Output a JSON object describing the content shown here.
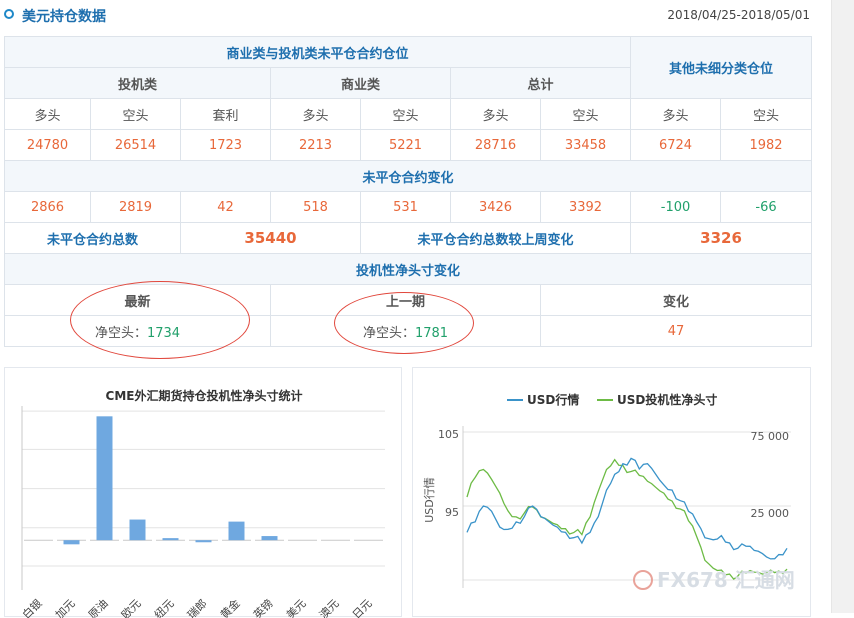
{
  "header": {
    "title": "美元持仓数据",
    "date_range": "2018/04/25-2018/05/01"
  },
  "table": {
    "group_commercial_noncommercial": "商业类与投机类未平仓合约仓位",
    "group_other": "其他未细分类仓位",
    "sub_speculative": "投机类",
    "sub_commercial": "商业类",
    "sub_total": "总计",
    "cols": [
      "多头",
      "空头",
      "套利",
      "多头",
      "空头",
      "多头",
      "空头",
      "多头",
      "空头"
    ],
    "positions": [
      "24780",
      "26514",
      "1723",
      "2213",
      "5221",
      "28716",
      "33458",
      "6724",
      "1982"
    ],
    "change_title": "未平仓合约变化",
    "changes": [
      "2866",
      "2819",
      "42",
      "518",
      "531",
      "3426",
      "3392",
      "-100",
      "-66"
    ],
    "oi_total_label": "未平仓合约总数",
    "oi_total_value": "35440",
    "oi_change_label": "未平仓合约总数较上周变化",
    "oi_change_value": "3326",
    "net_title": "投机性净头寸变化",
    "net_cols": [
      "最新",
      "上一期",
      "变化"
    ],
    "latest_label": "净空头：",
    "latest_value": "1734",
    "previous_label": "净空头：",
    "previous_value": "1781",
    "net_change": "47"
  },
  "colors": {
    "accent": "#1e6fae",
    "red": "#e8683a",
    "green": "#21a06b",
    "bar": "#6fa8e0",
    "usd_line": "#3a93c9",
    "net_line": "#6dbb45",
    "annotation": "#e1473c"
  },
  "chart_data": [
    {
      "type": "bar",
      "title": "CME外汇期货持仓投机性净头寸统计",
      "categories": [
        "白银",
        "加元",
        "原油",
        "欧元",
        "纽元",
        "瑞郎",
        "黄金",
        "英镑",
        "美元",
        "澳元",
        "日元"
      ],
      "values": [
        0,
        -4,
        120,
        20,
        2,
        -2,
        18,
        4,
        0,
        0,
        0
      ],
      "ylim": [
        -25,
        130
      ],
      "grid": true
    },
    {
      "type": "line",
      "legend": [
        "USD行情",
        "USD投机性净头寸"
      ],
      "left_axis": {
        "label": "USD行情",
        "ticks": [
          "105",
          "95"
        ]
      },
      "right_axis": {
        "ticks": [
          "75 000",
          "25 000"
        ]
      },
      "series": [
        {
          "name": "USD行情",
          "values": [
            95.5,
            96.5,
            98.0,
            97.5,
            96.0,
            95.8,
            96.5,
            97.0,
            98.0,
            97.0,
            96.5,
            96.0,
            95.5,
            95.0,
            94.5,
            95.5,
            97.0,
            99.5,
            101.0,
            102.0,
            102.5,
            101.5,
            102.0,
            101.0,
            100.0,
            99.5,
            98.5,
            97.5,
            96.5,
            95.0,
            94.8,
            95.2,
            94.5,
            94.0,
            94.2,
            93.8,
            93.5,
            93.0,
            93.4,
            94.0
          ]
        },
        {
          "name": "USD投机性净头寸",
          "values": [
            42000,
            52000,
            56000,
            51000,
            44000,
            35000,
            32000,
            34000,
            37000,
            32000,
            30000,
            28000,
            26000,
            24000,
            23000,
            32000,
            45000,
            56000,
            61000,
            58000,
            55000,
            53000,
            50000,
            47000,
            44000,
            40000,
            36000,
            30000,
            22000,
            10000,
            6000,
            5000,
            3000,
            2000,
            3500,
            4000,
            3000,
            5000,
            4500,
            5500
          ]
        }
      ]
    }
  ],
  "watermark": "FX678 汇通网"
}
